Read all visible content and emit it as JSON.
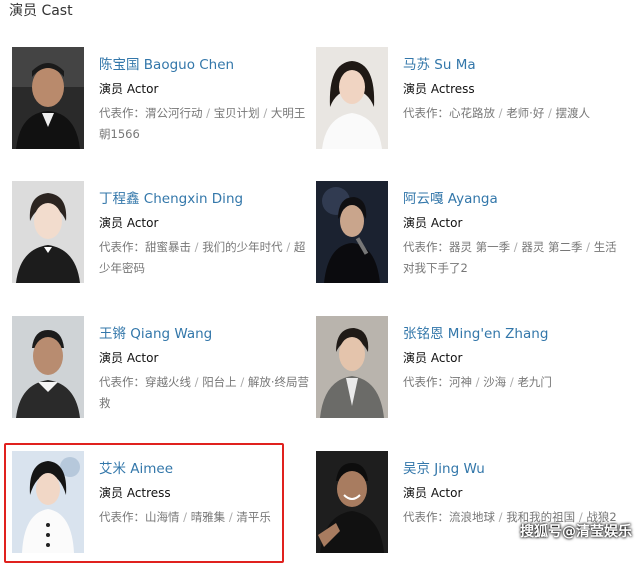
{
  "section": {
    "title": "演员 Cast"
  },
  "cast": [
    {
      "name": "陈宝国 Baoguo Chen",
      "role": "演员 Actor",
      "works_label": "代表作：",
      "works": [
        "渭公河行动",
        "宝贝计划",
        "大明王朝1566"
      ]
    },
    {
      "name": "马苏 Su Ma",
      "role": "演员 Actress",
      "works_label": "代表作：",
      "works": [
        "心花路放",
        "老师·好",
        "摆渡人"
      ]
    },
    {
      "name": "丁程鑫 Chengxin Ding",
      "role": "演员 Actor",
      "works_label": "代表作：",
      "works": [
        "甜蜜暴击",
        "我们的少年时代",
        "超少年密码"
      ]
    },
    {
      "name": "阿云嘎 Ayanga",
      "role": "演员 Actor",
      "works_label": "代表作：",
      "works": [
        "器灵 第一季",
        "器灵 第二季",
        "生活对我下手了2"
      ]
    },
    {
      "name": "王锵 Qiang Wang",
      "role": "演员 Actor",
      "works_label": "代表作：",
      "works": [
        "穿越火线",
        "阳台上",
        "解放·终局营救"
      ]
    },
    {
      "name": "张铭恩 Ming'en Zhang",
      "role": "演员 Actor",
      "works_label": "代表作：",
      "works": [
        "河神",
        "沙海",
        "老九门"
      ]
    },
    {
      "name": "艾米 Aimee",
      "role": "演员 Actress",
      "works_label": "代表作：",
      "works": [
        "山海情",
        "晴雅集",
        "清平乐"
      ]
    },
    {
      "name": "吴京 Jing Wu",
      "role": "演员 Actor",
      "works_label": "代表作：",
      "works": [
        "流浪地球",
        "我和我的祖国",
        "战狼2"
      ]
    }
  ],
  "watermark": {
    "text": "搜狐号@清莹娱乐"
  }
}
